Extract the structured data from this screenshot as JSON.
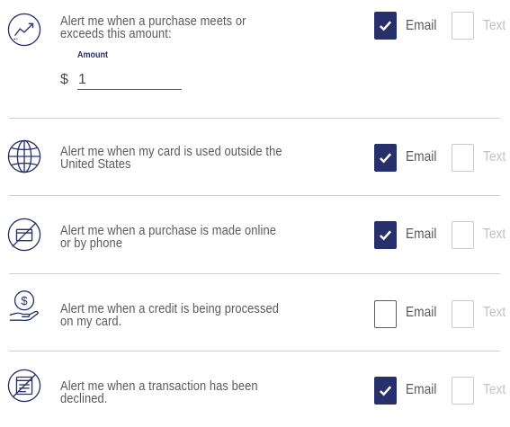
{
  "alerts": [
    {
      "id": "threshold",
      "description": "Alert me when a purchase meets or exceeds this amount:",
      "email_checked": true
    },
    {
      "id": "outside-us",
      "description": "Alert me when my card is used outside the United States",
      "email_checked": true
    },
    {
      "id": "online-phone",
      "description": "Alert me when a purchase is made online or by phone",
      "email_checked": true
    },
    {
      "id": "credit",
      "description": "Alert me when a credit is being processed on my card.",
      "email_checked": false
    },
    {
      "id": "declined",
      "description": "Alert me when a transaction has been declined.",
      "email_checked": true
    }
  ],
  "labels": {
    "email": "Email",
    "text": "Text"
  },
  "amount": {
    "label": "Amount",
    "currency": "$",
    "value": "1"
  },
  "icons": [
    "trend-up-icon",
    "globe-icon",
    "no-card-icon",
    "dollar-hand-icon",
    "declined-card-icon"
  ],
  "colors": {
    "accent": "#27306b",
    "text": "#5a5a5a",
    "disabled": "#c2c2c2",
    "divider": "#cfcfcf"
  }
}
